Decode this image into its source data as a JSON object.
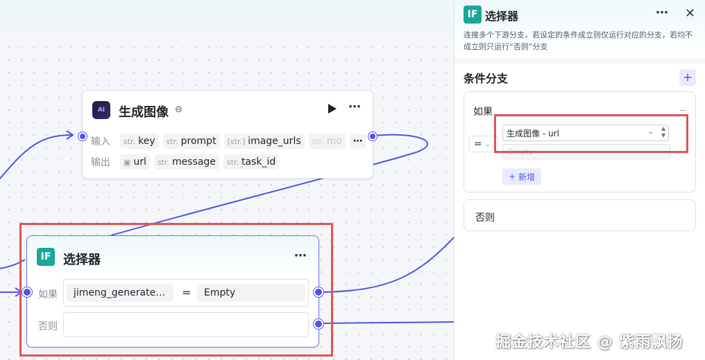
{
  "image_node": {
    "title": "生成图像",
    "avatar_text": "AI",
    "input_label": "输入",
    "output_label": "输出",
    "inputs": [
      {
        "type": "str.",
        "name": "key"
      },
      {
        "type": "str.",
        "name": "prompt"
      },
      {
        "type": "[str.]",
        "name": "image_urls"
      },
      {
        "type": "str.",
        "name": "mo"
      }
    ],
    "outputs": [
      {
        "type": "img",
        "name": "url"
      },
      {
        "type": "str.",
        "name": "message"
      },
      {
        "type": "str.",
        "name": "task_id"
      }
    ],
    "more": "⋯"
  },
  "selector_node": {
    "icon_text": "IF",
    "title": "选择器",
    "if_label": "如果",
    "else_label": "否则",
    "condition_left": "jimeng_generate…",
    "condition_op": "=",
    "condition_right": "Empty",
    "more": "⋯"
  },
  "panel": {
    "icon_text": "IF",
    "title": "选择器",
    "more": "⋯",
    "close": "✕",
    "description": "连接多个下游分支，若设定的条件成立则仅运行对应的分支，若均不成立则只运行“否则”分支",
    "section_title": "条件分支",
    "add": "+",
    "if_label": "如果",
    "operator": "=",
    "left_value": "生成图像 - url",
    "right_placeholder": "Empty",
    "add_button": "新增",
    "else_label": "否则"
  },
  "watermark": "掘金技术社区 @ 紫雨飘扬",
  "colors": {
    "accent": "#4e54e6",
    "highlight": "#e0534f",
    "if_icon": "#1aa69a"
  }
}
